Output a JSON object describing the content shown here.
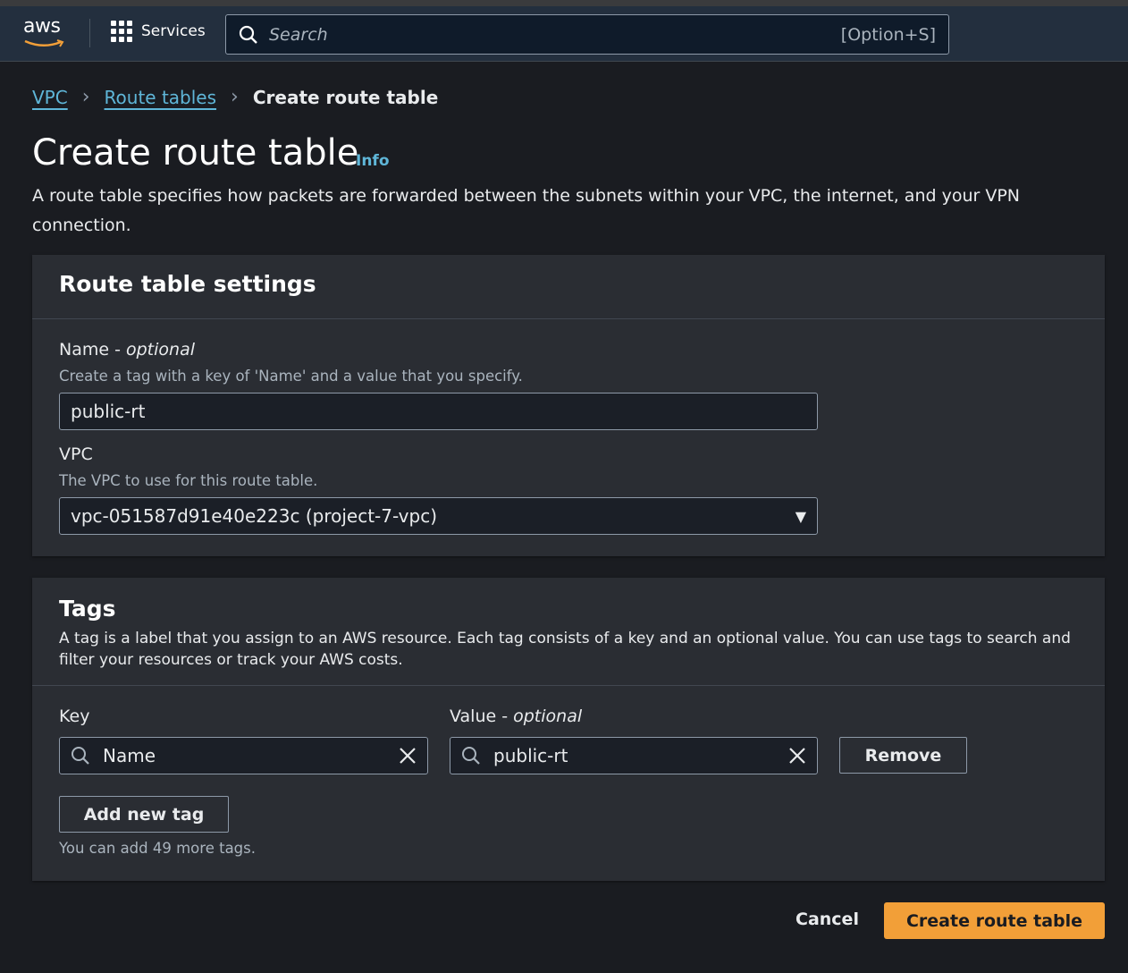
{
  "header": {
    "logo_text": "aws",
    "services_label": "Services",
    "search_placeholder": "Search",
    "search_shortcut": "[Option+S]"
  },
  "breadcrumb": {
    "items": [
      "VPC",
      "Route tables"
    ],
    "current": "Create route table"
  },
  "page": {
    "title": "Create route table",
    "info_link": "Info",
    "description": "A route table specifies how packets are forwarded between the subnets within your VPC, the internet, and your VPN connection."
  },
  "settings": {
    "title": "Route table settings",
    "name_label": "Name",
    "name_optional": "optional",
    "name_hint": "Create a tag with a key of 'Name' and a value that you specify.",
    "name_value": "public-rt",
    "vpc_label": "VPC",
    "vpc_hint": "The VPC to use for this route table.",
    "vpc_value": "vpc-051587d91e40e223c (project-7-vpc)"
  },
  "tags": {
    "title": "Tags",
    "description": "A tag is a label that you assign to an AWS resource. Each tag consists of a key and an optional value. You can use tags to search and filter your resources or track your AWS costs.",
    "key_label": "Key",
    "value_label": "Value",
    "value_optional": "optional",
    "key_value": "Name",
    "value_value": "public-rt",
    "remove_label": "Remove",
    "add_label": "Add new tag",
    "remaining": "You can add 49 more tags."
  },
  "footer": {
    "cancel_label": "Cancel",
    "submit_label": "Create route table"
  },
  "colors": {
    "accent": "#f29f38",
    "link": "#5fb6d8",
    "header_bg": "#232f3e"
  }
}
